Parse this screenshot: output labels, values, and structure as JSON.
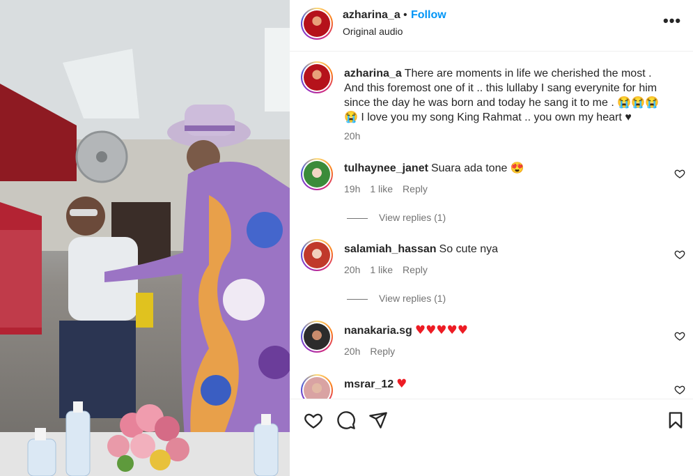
{
  "header": {
    "username": "azharina_a",
    "separator": "•",
    "follow_label": "Follow",
    "audio_label": "Original audio",
    "more_label": "•••"
  },
  "caption": {
    "username": "azharina_a",
    "text": "There are moments in life we cherished the most . And this foremost one of it .. this lullaby I sang everynite for him since the day he was born and today he sang it to me . 😭😭😭😭 I love you my song King Rahmat .. you own my heart ♥",
    "time": "20h"
  },
  "comments": [
    {
      "username": "tulhaynee_janet",
      "text": "Suara ada tone 😍",
      "time": "19h",
      "likes": "1 like",
      "reply_label": "Reply",
      "view_replies": "View replies (1)",
      "avatar_color": "#3b8b3a"
    },
    {
      "username": "salamiah_hassan",
      "text": "So cute nya",
      "time": "20h",
      "likes": "1 like",
      "reply_label": "Reply",
      "view_replies": "View replies (1)",
      "avatar_color": "#c0392b"
    },
    {
      "username": "nanakaria.sg",
      "text": "♥♥♥♥♥",
      "time": "20h",
      "reply_label": "Reply",
      "avatar_color": "#2c2c2c"
    },
    {
      "username": "msrar_12",
      "text": "♥",
      "avatar_color": "#d9a3a3"
    }
  ],
  "icons": {
    "like": "heart-icon",
    "comment": "comment-icon",
    "share": "paper-plane-icon",
    "save": "bookmark-icon",
    "more": "more-options-icon"
  },
  "colors": {
    "follow_blue": "#0095f6",
    "meta_gray": "#737373",
    "heart_red": "#ed1c24"
  }
}
